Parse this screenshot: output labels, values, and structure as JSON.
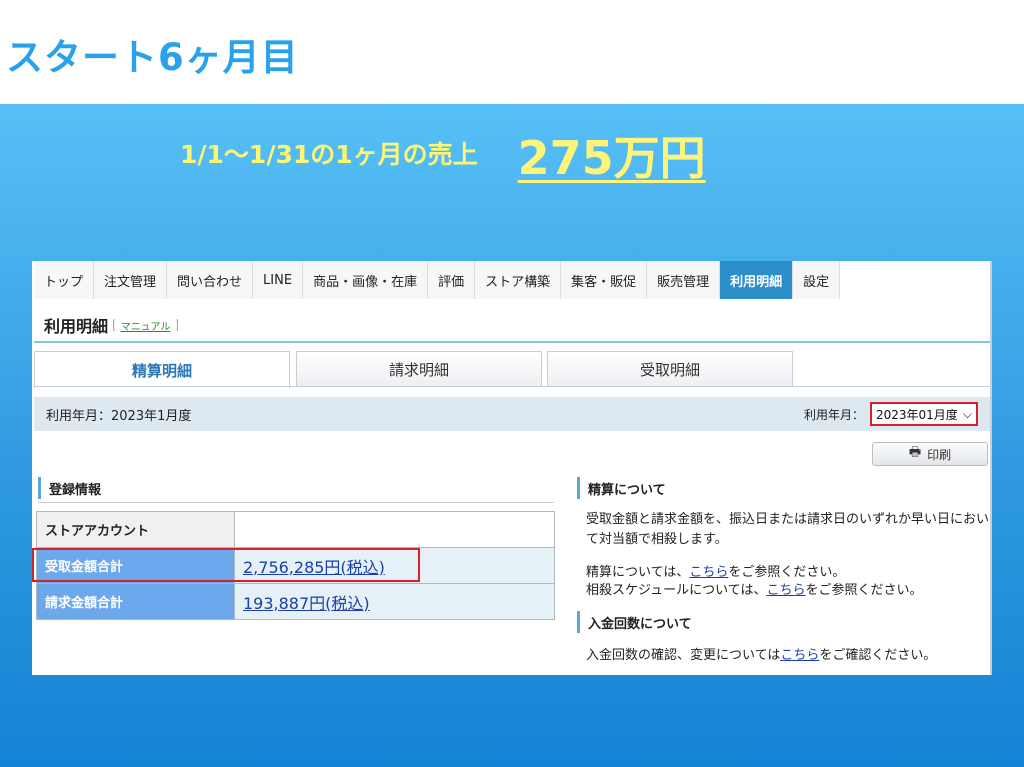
{
  "slide": {
    "title": "スタート6ヶ月目",
    "headline_dates": "1/1〜1/31",
    "headline_rest": "の1ヶ月の売上",
    "headline_amount": "275万円"
  },
  "nav": {
    "items": [
      "トップ",
      "注文管理",
      "問い合わせ",
      "LINE",
      "商品・画像・在庫",
      "評価",
      "ストア構築",
      "集客・販促",
      "販売管理",
      "利用明細",
      "設定"
    ],
    "active_index": 9
  },
  "page": {
    "title": "利用明細",
    "manual_link": "マニュアル"
  },
  "tabs": [
    "精算明細",
    "請求明細",
    "受取明細"
  ],
  "usage": {
    "period_text": "利用年月：2023年1月度",
    "select_label": "利用年月：",
    "select_value": "2023年01月度"
  },
  "print_button": "印刷",
  "registration": {
    "heading": "登録情報",
    "rows": [
      {
        "label": "ストアアカウント",
        "value": ""
      },
      {
        "label": "受取金額合計",
        "value": "2,756,285円(税込)"
      },
      {
        "label": "請求金額合計",
        "value": "193,887円(税込)"
      }
    ]
  },
  "settlement": {
    "heading": "精算について",
    "description": "受取金額と請求金額を、振込日または請求日のいずれか早い日において対当額で相殺します。",
    "ref1_before": "精算については、",
    "ref1_link": "こちら",
    "ref1_after": "をご参照ください。",
    "ref2_before": "相殺スケジュールについては、",
    "ref2_link": "こちら",
    "ref2_after": "をご参照ください。"
  },
  "deposit": {
    "heading": "入金回数について",
    "text_before": "入金回数の確認、変更については",
    "link": "こちら",
    "text_after": "をご確認ください。"
  },
  "colors": {
    "band_top": "#58c0f7",
    "band_bottom": "#1583d5",
    "headline_yellow": "#fff37a",
    "title_blue": "#27a2ec",
    "highlight_red": "#d2232a"
  }
}
